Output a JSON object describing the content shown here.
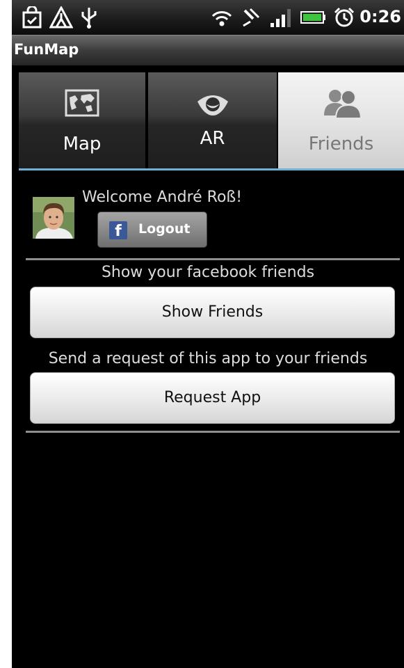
{
  "status_bar": {
    "icons": [
      "shopping-bag-icon",
      "warning-icon",
      "usb-icon",
      "wifi-icon",
      "gps-icon",
      "signal-icon",
      "battery-icon",
      "alarm-icon"
    ],
    "time": "0:26"
  },
  "app": {
    "title": "FunMap"
  },
  "tabs": [
    {
      "label": "Map",
      "icon": "map-icon",
      "active": false
    },
    {
      "label": "AR",
      "icon": "eye-icon",
      "active": false
    },
    {
      "label": "Friends",
      "icon": "friends-icon",
      "active": true
    }
  ],
  "colors": {
    "tab_indicator": "#6db3d9",
    "facebook_blue": "#3b5998",
    "background": "#000000"
  },
  "user": {
    "welcome": "Welcome André Roß!",
    "logout_label": "Logout"
  },
  "friends_section": {
    "caption": "Show your facebook friends",
    "button_label": "Show Friends"
  },
  "request_section": {
    "caption": "Send a request of this app to your friends",
    "button_label": "Request App"
  }
}
